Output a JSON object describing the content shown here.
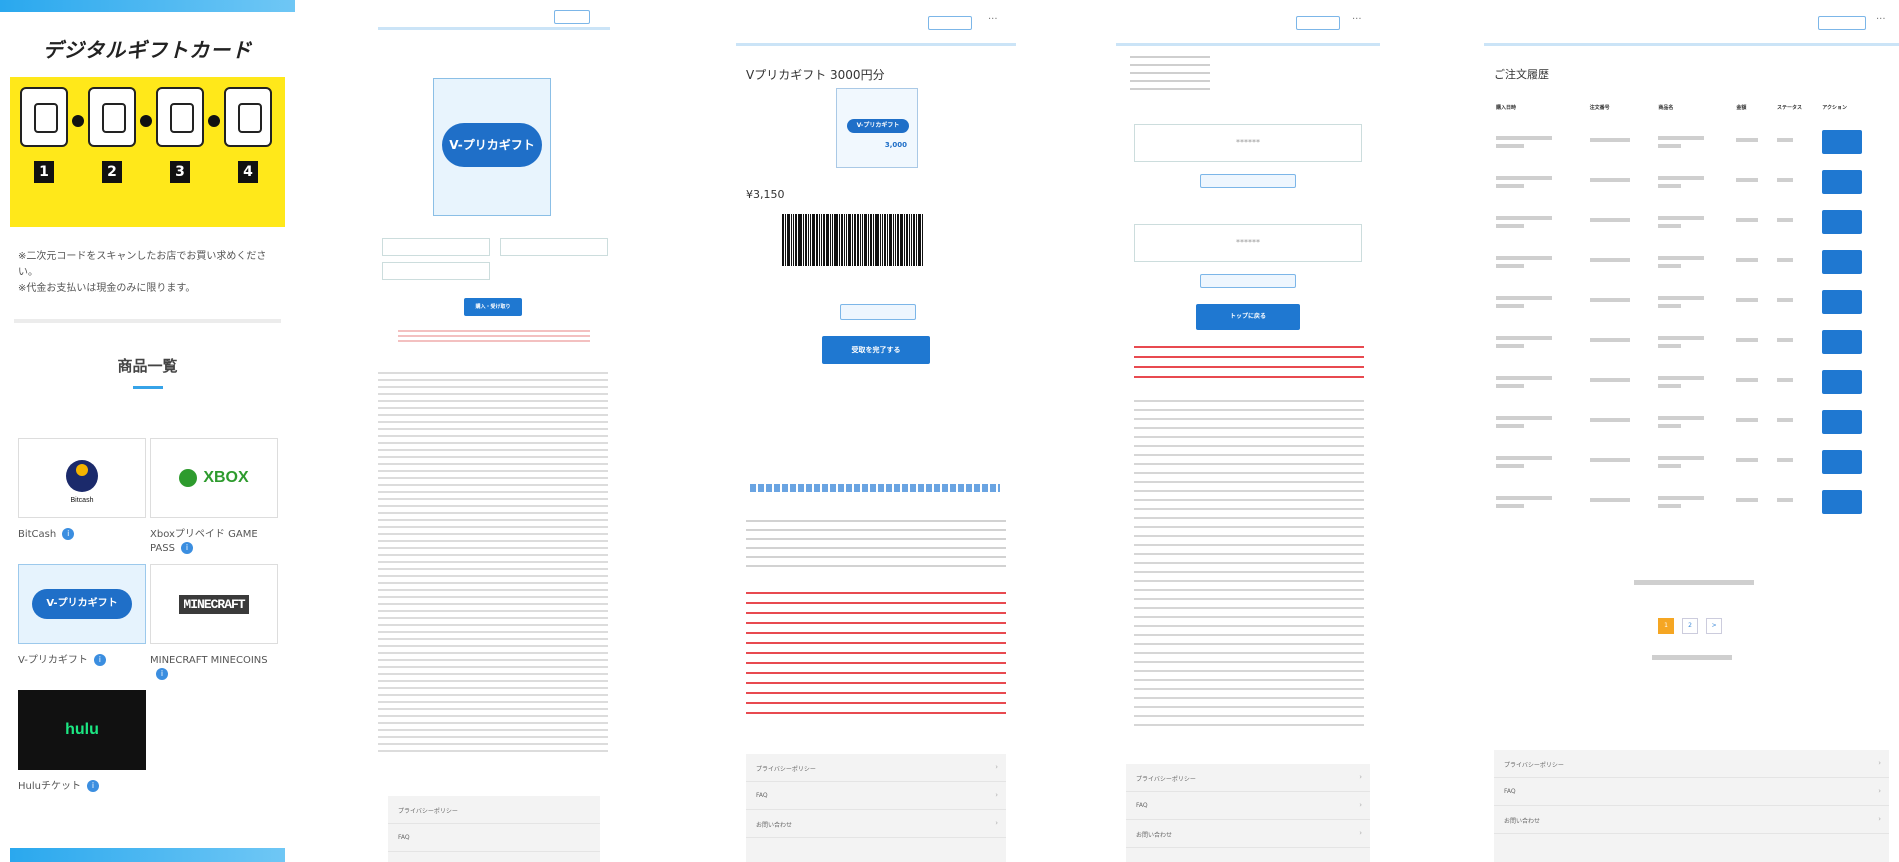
{
  "landing": {
    "brand": "デジタルギフトカード",
    "steps": [
      "1",
      "2",
      "3",
      "4"
    ],
    "notes": [
      "※二次元コードをスキャンしたお店でお買い求めください。",
      "※代金お支払いは現金のみに限ります。"
    ],
    "heading": "商品一覧",
    "products": [
      {
        "logo": "Bitcash",
        "name": "BitCash"
      },
      {
        "logo": "XBOX",
        "name": "Xboxプリペイド GAME PASS"
      },
      {
        "logo": "V-プリカギフト",
        "name": "V-プリカギフト"
      },
      {
        "logo": "MINECRAFT",
        "name": "MINECRAFT MINECOINS"
      },
      {
        "logo": "hulu",
        "name": "Huluチケット"
      }
    ]
  },
  "screen2": {
    "card_logo": "V-プリカギフト",
    "submit_label": "購入・受け取り"
  },
  "screen3": {
    "title": "Vプリカギフト 3000円分",
    "card_pill": "V-プリカギフト",
    "card_amount": "3,000",
    "price": "¥3,150",
    "primary_label": "受取を完了する"
  },
  "screen4": {
    "primary_label": "トップに戻る"
  },
  "screen5": {
    "title": "ご注文履歴",
    "columns": [
      "購入日時",
      "注文番号",
      "商品名",
      "金額",
      "ステータス",
      "アクション"
    ],
    "pager": [
      "1",
      "2",
      ">"
    ]
  },
  "footer": {
    "links": [
      "プライバシーポリシー",
      "FAQ",
      "お問い合わせ"
    ]
  },
  "colors": {
    "accent": "#1f78d1",
    "banner": "#ffe81a",
    "warning": "#e0222a"
  }
}
